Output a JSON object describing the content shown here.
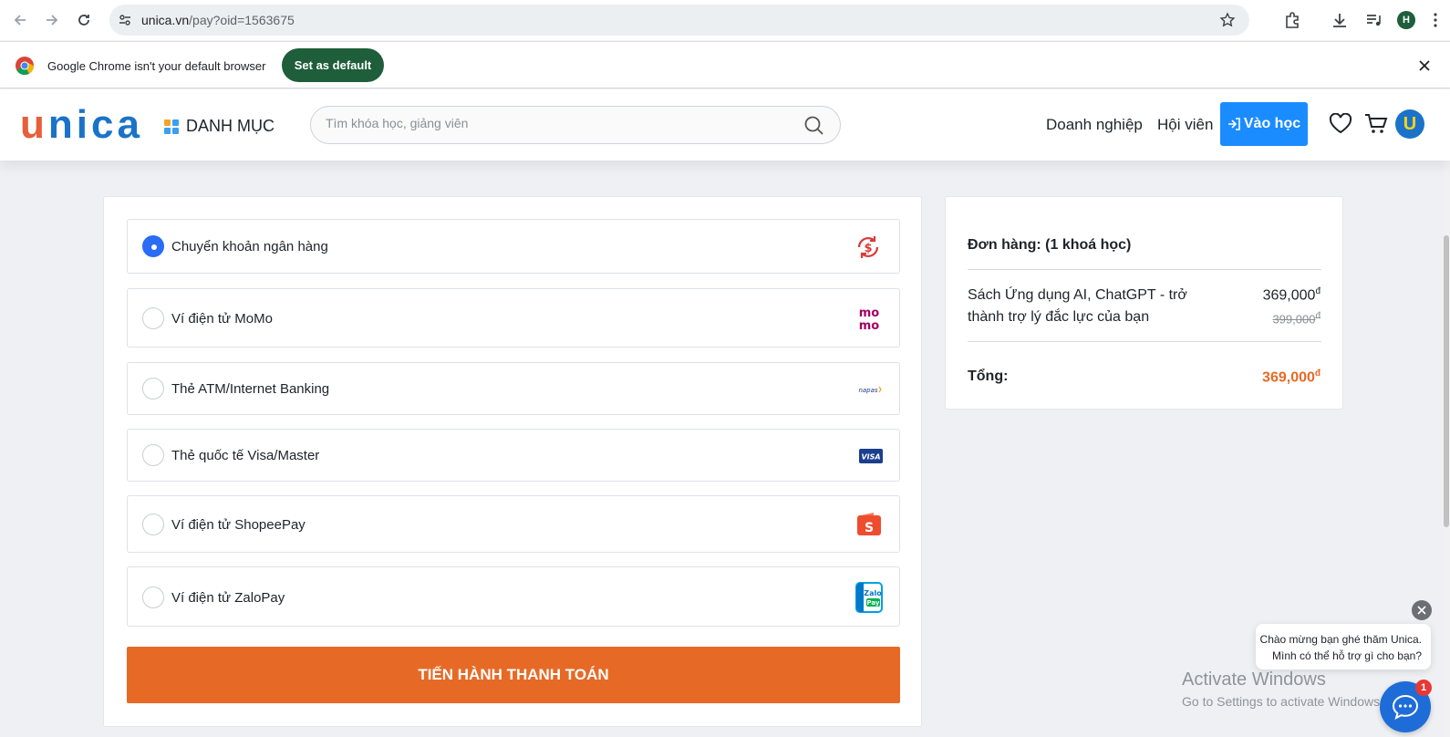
{
  "browser": {
    "url_host": "unica.vn",
    "url_path": "/pay?oid=1563675",
    "profile_initial": "H",
    "infobar_message": "Google Chrome isn't your default browser",
    "set_default_label": "Set as default"
  },
  "header": {
    "logo": "unica",
    "category_label": "DANH MỤC",
    "search_placeholder": "Tìm khóa học, giảng viên",
    "nav": [
      "Doanh nghiệp",
      "Hội viên"
    ],
    "login_label": "Vào học",
    "avatar_initial": "U"
  },
  "payment": {
    "methods": [
      {
        "label": "Chuyển khoản ngân hàng",
        "logo": "bank-transfer-icon",
        "selected": true
      },
      {
        "label": "Ví điện tử MoMo",
        "logo": "momo-icon",
        "selected": false
      },
      {
        "label": "Thẻ ATM/Internet Banking",
        "logo": "napas-icon",
        "selected": false
      },
      {
        "label": "Thẻ quốc tế Visa/Master",
        "logo": "visa-icon",
        "selected": false
      },
      {
        "label": "Ví điện tử ShopeePay",
        "logo": "shopeepay-icon",
        "selected": false
      },
      {
        "label": "Ví điện tử ZaloPay",
        "logo": "zalopay-icon",
        "selected": false
      }
    ],
    "submit_label": "TIẾN HÀNH THANH TOÁN"
  },
  "order": {
    "title": "Đơn hàng: (1 khoá học)",
    "item_name": "Sách Ứng dụng AI, ChatGPT - trở thành trợ lý đắc lực của bạn",
    "price": "369,000",
    "old_price": "399,000",
    "currency": "đ",
    "total_label": "Tổng:",
    "total_value": "369,000"
  },
  "chat": {
    "line1": "Chào mừng bạn ghé thăm Unica.",
    "line2": "Mình có thể hỗ trợ gì cho bạn?",
    "badge": "1"
  },
  "watermark": {
    "line1": "Activate Windows",
    "line2": "Go to Settings to activate Windows."
  },
  "colors": {
    "accent_orange": "#e66a26",
    "login_blue": "#1a8cff",
    "radio_blue": "#2a6cf6",
    "chrome_green": "#1e5e3a"
  }
}
